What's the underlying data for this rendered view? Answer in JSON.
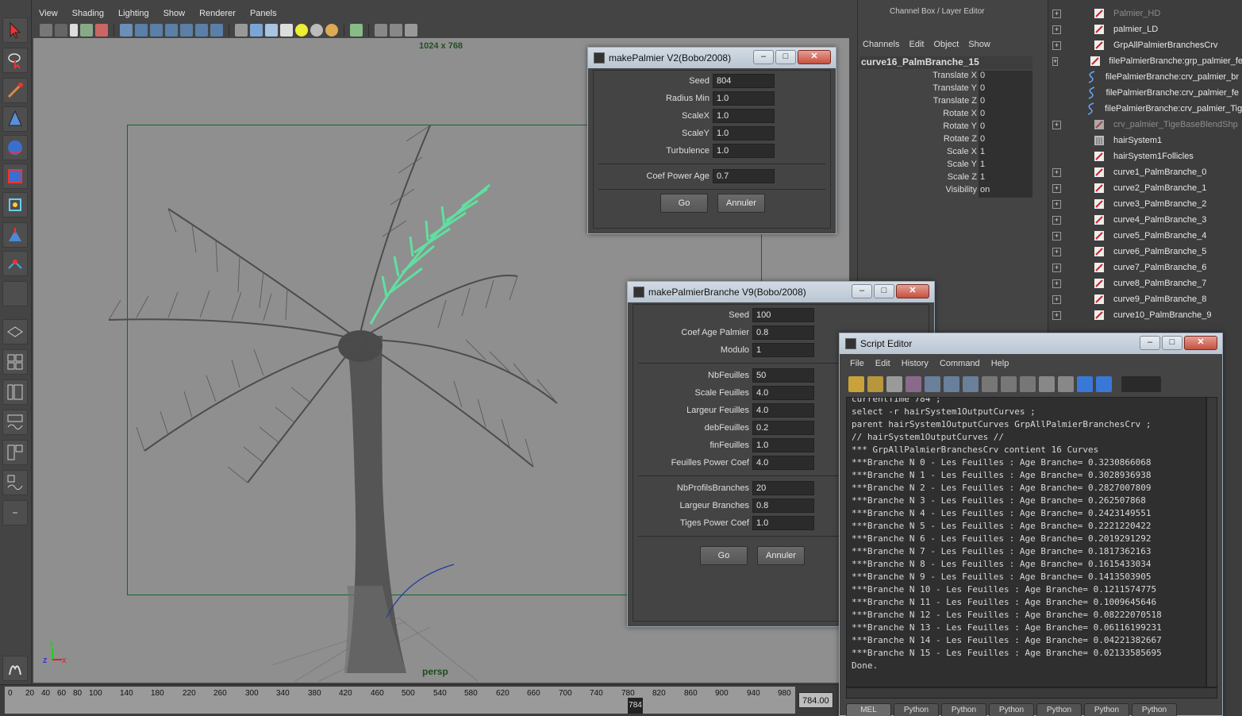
{
  "viewport": {
    "menu": [
      "View",
      "Shading",
      "Lighting",
      "Show",
      "Renderer",
      "Panels"
    ],
    "resolution_label": "1024 x 768",
    "camera_label": "persp"
  },
  "timeline": {
    "ticks": [
      "0",
      "20",
      "40",
      "60",
      "80",
      "100",
      "140",
      "180",
      "220",
      "260",
      "300",
      "340",
      "380",
      "420",
      "460",
      "500",
      "540",
      "580",
      "620",
      "660",
      "700",
      "740",
      "780",
      "820",
      "860",
      "900",
      "940",
      "980"
    ],
    "current_frame": "784",
    "time_field": "784.00"
  },
  "channel_box": {
    "title": "Channel Box / Layer Editor",
    "menu": [
      "Channels",
      "Edit",
      "Object",
      "Show"
    ],
    "node_name": "curve16_PalmBranche_15",
    "attributes": [
      {
        "name": "Translate X",
        "value": "0"
      },
      {
        "name": "Translate Y",
        "value": "0"
      },
      {
        "name": "Translate Z",
        "value": "0"
      },
      {
        "name": "Rotate X",
        "value": "0"
      },
      {
        "name": "Rotate Y",
        "value": "0"
      },
      {
        "name": "Rotate Z",
        "value": "0"
      },
      {
        "name": "Scale X",
        "value": "1"
      },
      {
        "name": "Scale Y",
        "value": "1"
      },
      {
        "name": "Scale Z",
        "value": "1"
      },
      {
        "name": "Visibility",
        "value": "on"
      }
    ]
  },
  "outliner": {
    "items": [
      {
        "label": "Palmier_HD",
        "dim": true
      },
      {
        "label": "palmier_LD",
        "dim": false
      },
      {
        "label": "GrpAllPalmierBranchesCrv",
        "dim": false
      },
      {
        "label": "filePalmierBranche:grp_palmier_fe",
        "dim": false
      },
      {
        "label": "filePalmierBranche:crv_palmier_br",
        "dim": false
      },
      {
        "label": "filePalmierBranche:crv_palmier_fe",
        "dim": false
      },
      {
        "label": "filePalmierBranche:crv_palmier_Tig",
        "dim": false
      },
      {
        "label": "crv_palmier_TigeBaseBlendShp",
        "dim": true
      },
      {
        "label": "hairSystem1",
        "dim": false
      },
      {
        "label": "hairSystem1Follicles",
        "dim": false
      },
      {
        "label": "curve1_PalmBranche_0",
        "dim": false
      },
      {
        "label": "curve2_PalmBranche_1",
        "dim": false
      },
      {
        "label": "curve3_PalmBranche_2",
        "dim": false
      },
      {
        "label": "curve4_PalmBranche_3",
        "dim": false
      },
      {
        "label": "curve5_PalmBranche_4",
        "dim": false
      },
      {
        "label": "curve6_PalmBranche_5",
        "dim": false
      },
      {
        "label": "curve7_PalmBranche_6",
        "dim": false
      },
      {
        "label": "curve8_PalmBranche_7",
        "dim": false
      },
      {
        "label": "curve9_PalmBranche_8",
        "dim": false
      },
      {
        "label": "curve10_PalmBranche_9",
        "dim": false
      }
    ]
  },
  "make_palmier": {
    "title": "makePalmier V2(Bobo/2008)",
    "fields": [
      {
        "label": "Seed",
        "value": "804"
      },
      {
        "label": "Radius Min",
        "value": "1.0"
      },
      {
        "label": "ScaleX",
        "value": "1.0"
      },
      {
        "label": "ScaleY",
        "value": "1.0"
      },
      {
        "label": "Turbulence",
        "value": "1.0"
      }
    ],
    "coef_power_age": {
      "label": "Coef Power Age",
      "value": "0.7"
    },
    "go_label": "Go",
    "cancel_label": "Annuler"
  },
  "make_palmier_branche": {
    "title": "makePalmierBranche V9(Bobo/2008)",
    "group1": [
      {
        "label": "Seed",
        "value": "100"
      },
      {
        "label": "Coef Age Palmier",
        "value": "0.8"
      },
      {
        "label": "Modulo",
        "value": "1"
      }
    ],
    "group2": [
      {
        "label": "NbFeuilles",
        "value": "50"
      },
      {
        "label": "Scale Feuilles",
        "value": "4.0"
      },
      {
        "label": "Largeur Feuilles",
        "value": "4.0"
      },
      {
        "label": "debFeuilles",
        "value": "0.2"
      },
      {
        "label": "finFeuilles",
        "value": "1.0"
      },
      {
        "label": "Feuilles Power Coef",
        "value": "4.0"
      }
    ],
    "group3": [
      {
        "label": "NbProfilsBranches",
        "value": "20"
      },
      {
        "label": "Largeur Branches",
        "value": "0.8"
      },
      {
        "label": "Tiges Power Coef",
        "value": "1.0"
      }
    ],
    "go_label": "Go",
    "cancel_label": "Annuler"
  },
  "script_editor": {
    "title": "Script Editor",
    "menu": [
      "File",
      "Edit",
      "History",
      "Command",
      "Help"
    ],
    "lines": [
      "currentTime 784 ;",
      "select -r hairSystem1OutputCurves ;",
      "parent hairSystem1OutputCurves GrpAllPalmierBranchesCrv ;",
      "// hairSystem1OutputCurves //",
      "*** GrpAllPalmierBranchesCrv contient 16 Curves",
      "***Branche N 0 - Les Feuilles : Age Branche= 0.3230866068",
      "***Branche N 1 - Les Feuilles : Age Branche= 0.3028936938",
      "***Branche N 2 - Les Feuilles : Age Branche= 0.2827007809",
      "***Branche N 3 - Les Feuilles : Age Branche= 0.262507868",
      "***Branche N 4 - Les Feuilles : Age Branche= 0.2423149551",
      "***Branche N 5 - Les Feuilles : Age Branche= 0.2221220422",
      "***Branche N 6 - Les Feuilles : Age Branche= 0.2019291292",
      "***Branche N 7 - Les Feuilles : Age Branche= 0.1817362163",
      "***Branche N 8 - Les Feuilles : Age Branche= 0.1615433034",
      "***Branche N 9 - Les Feuilles : Age Branche= 0.1413503905",
      "***Branche N 10 - Les Feuilles : Age Branche= 0.1211574775",
      "***Branche N 11 - Les Feuilles : Age Branche= 0.1009645646",
      "***Branche N 12 - Les Feuilles : Age Branche= 0.08222070518",
      "***Branche N 13 - Les Feuilles : Age Branche= 0.06116199231",
      "***Branche N 14 - Les Feuilles : Age Branche= 0.04221382667",
      "***Branche N 15 - Les Feuilles : Age Branche= 0.02133585695",
      "Done."
    ],
    "tabs": [
      "MEL",
      "Python",
      "Python",
      "Python",
      "Python",
      "Python",
      "Python"
    ]
  }
}
